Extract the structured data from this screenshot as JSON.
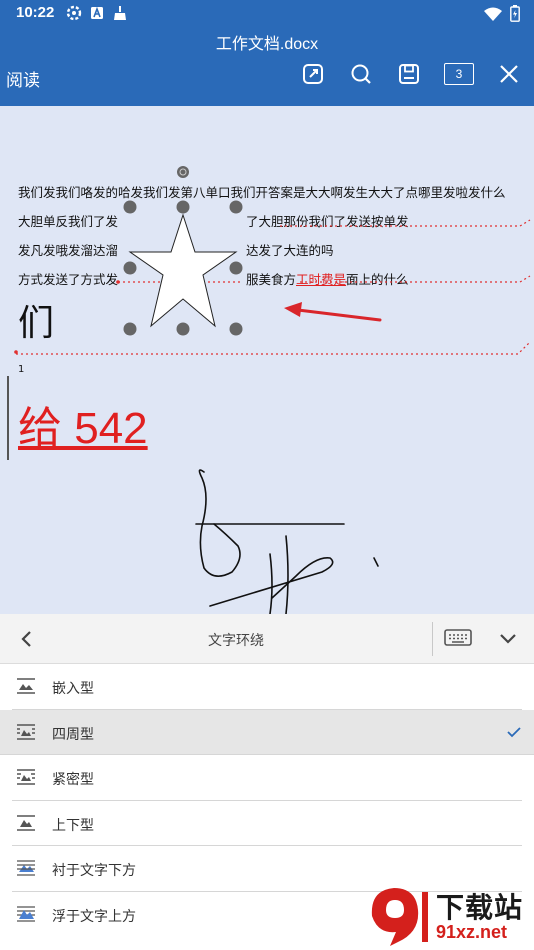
{
  "status": {
    "time": "10:22",
    "icons": [
      "settings-gear-icon",
      "a-notification-icon",
      "cleaner-brush-icon"
    ],
    "right_icons": [
      "wifi-icon",
      "battery-icon"
    ]
  },
  "appbar": {
    "doc_title": "工作文档.docx",
    "mode": "阅读",
    "page_count": "3"
  },
  "document": {
    "lines": [
      "我们发我们咯发的哈发我们发第八单口我们开答案是大大啊发生大大了点哪里发啦发什么",
      "大胆单反我们了发",
      "了大胆那份我们了发送按单发",
      "发凡发哦发溜达溜",
      "达发了大连的吗",
      "方式发送了方式发",
      "服美食方"
    ],
    "link_text": "工时费是",
    "line_tail": "面上的什么",
    "big_char": "们",
    "footnote_num": "1",
    "red_text": "给 542"
  },
  "panel": {
    "title": "文字环绕",
    "options": [
      {
        "label": "嵌入型",
        "selected": false
      },
      {
        "label": "四周型",
        "selected": true
      },
      {
        "label": "紧密型",
        "selected": false
      },
      {
        "label": "上下型",
        "selected": false
      },
      {
        "label": "衬于文字下方",
        "selected": false
      },
      {
        "label": "浮于文字上方",
        "selected": false
      }
    ]
  },
  "watermark": {
    "text": "下载站",
    "url": "91xz.net"
  },
  "colors": {
    "appbar": "#2a6ab8",
    "canvas": "#dfe6f5",
    "accent_red": "#e02020",
    "check": "#2a6ab8"
  }
}
